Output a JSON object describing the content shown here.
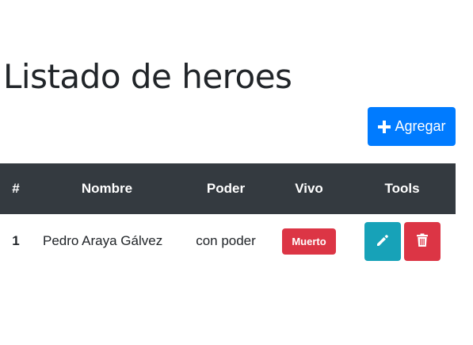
{
  "page": {
    "title": "Listado de heroes"
  },
  "toolbar": {
    "add_label": "Agregar",
    "add_icon": "plus-icon"
  },
  "table": {
    "headers": [
      "#",
      "Nombre",
      "Poder",
      "Vivo",
      "Tools"
    ],
    "rows": [
      {
        "num": "1",
        "name": "Pedro Araya Gálvez",
        "power": "con poder",
        "alive": "Muerto",
        "tools": {
          "edit_icon": "pencil-icon",
          "delete_icon": "trash-icon"
        }
      }
    ]
  },
  "colors": {
    "primary": "#007bff",
    "danger": "#dc3545",
    "info": "#17a2b8",
    "table_header": "#343a40"
  }
}
